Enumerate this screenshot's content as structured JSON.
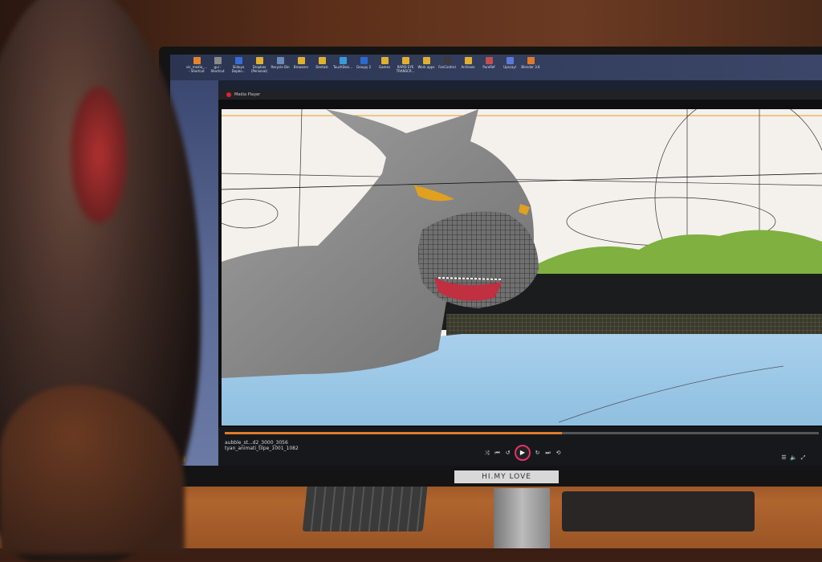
{
  "desktop_icons": [
    "vlc_media_... - Shortcut",
    "gui - Shortcut",
    "Slidoyo Dopbo...",
    "Dropbox (Personal)",
    "Recycle Bin",
    "Browsers",
    "Dentals",
    "TouchDesi...",
    "Groupy 2",
    "Games",
    "RAPID EYE TRANSCR...",
    "Work apps",
    "FanControl",
    "Archives",
    "PureRef",
    "Upscayl",
    "Blender 3.6"
  ],
  "player": {
    "window_title": "Media Player",
    "file_name_line1": "aubble_st...d2_3000_3056",
    "file_name_line2": "tyan_animati_tilpe_1001_1082"
  },
  "monitor_label": "HI.MY LOVE",
  "colors": {
    "accent": "#e07a2a",
    "play_ring": "#e2336a",
    "sky": "#f4f1ec",
    "ground": "#9fc8e6",
    "hills": "#7fb040",
    "character": "#8e8e8e"
  }
}
